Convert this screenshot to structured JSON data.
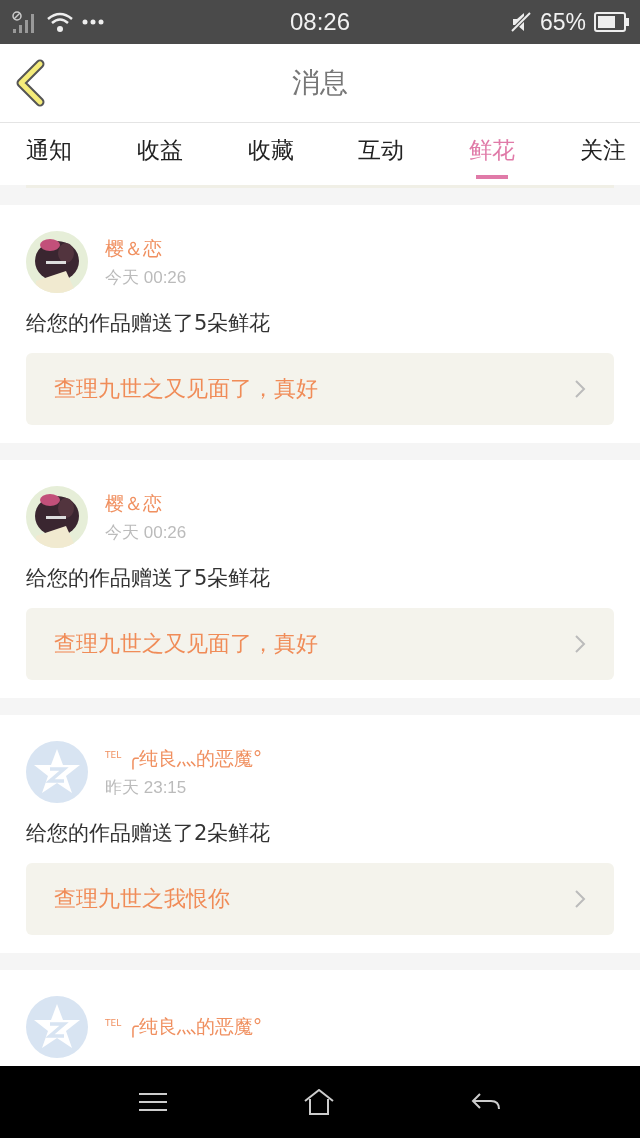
{
  "status_bar": {
    "time": "08:26",
    "battery": "65%"
  },
  "header": {
    "title": "消息"
  },
  "tabs": [
    {
      "label": "通知",
      "selected": false
    },
    {
      "label": "收益",
      "selected": false
    },
    {
      "label": "收藏",
      "selected": false
    },
    {
      "label": "互动",
      "selected": false
    },
    {
      "label": "鲜花",
      "selected": true
    },
    {
      "label": "关注",
      "selected": false
    }
  ],
  "messages": [
    {
      "name": "樱＆恋",
      "time": "今天 00:26",
      "text": "给您的作品赠送了5朵鲜花",
      "work": "查理九世之又见面了，真好"
    },
    {
      "name": "樱＆恋",
      "time": "今天 00:26",
      "text": "给您的作品赠送了5朵鲜花",
      "work": "查理九世之又见面了，真好"
    },
    {
      "kind": "default",
      "name": "$^{TEL}$ ╭纯良灬的恶魔°",
      "time": "昨天 23:15",
      "text": "给您的作品赠送了2朵鲜花",
      "work": "查理九世之我恨你"
    },
    {
      "kind": "default",
      "name": "$^{TEL}$ ╭纯良灬的恶魔°"
    }
  ]
}
